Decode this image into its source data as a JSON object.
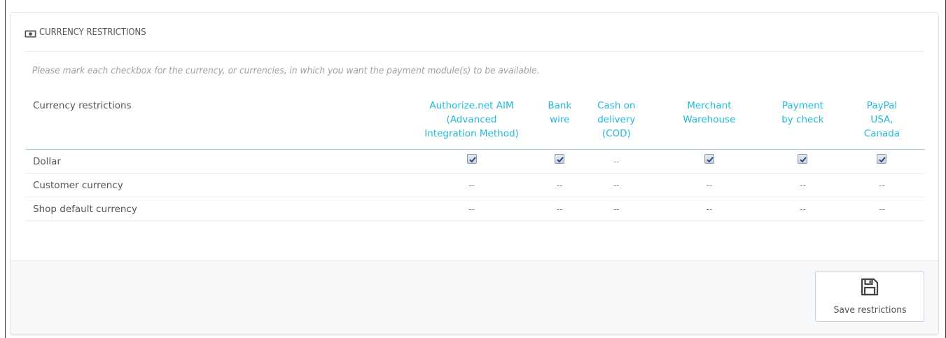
{
  "panel": {
    "icon": "money-icon",
    "title": "CURRENCY RESTRICTIONS",
    "help_text": "Please mark each checkbox for the currency, or currencies, in which you want the payment module(s) to be available."
  },
  "table": {
    "header_label": "Currency restrictions",
    "modules": [
      "Authorize.net AIM (Advanced Integration Method)",
      "Bank wire",
      "Cash on delivery (COD)",
      "Merchant Warehouse",
      "Payment by check",
      "PayPal USA, Canada"
    ],
    "rows": [
      {
        "label": "Dollar",
        "cells": [
          "checked",
          "checked",
          "--",
          "checked",
          "checked",
          "checked"
        ]
      },
      {
        "label": "Customer currency",
        "cells": [
          "--",
          "--",
          "--",
          "--",
          "--",
          "--"
        ]
      },
      {
        "label": "Shop default currency",
        "cells": [
          "--",
          "--",
          "--",
          "--",
          "--",
          "--"
        ]
      }
    ]
  },
  "footer": {
    "save_icon": "floppy-disk-icon",
    "save_label": "Save restrictions"
  },
  "colors": {
    "accent": "#25b9d7",
    "text": "#555555",
    "help": "#a0a0a0",
    "footer_bg": "#f6f8fa"
  }
}
